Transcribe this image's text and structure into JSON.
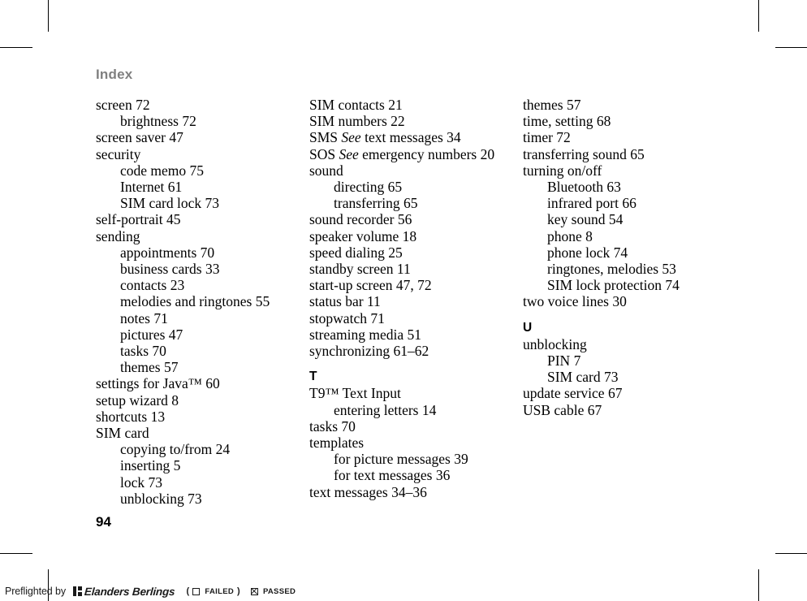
{
  "document": {
    "heading": "Index",
    "page_number": "94",
    "heading_color": "#808080",
    "text_color": "#000000"
  },
  "columns": [
    {
      "id": "column-1",
      "entries": [
        {
          "type": "main",
          "text": "screen 72"
        },
        {
          "type": "sub",
          "text": "brightness 72"
        },
        {
          "type": "main",
          "text": "screen saver 47"
        },
        {
          "type": "main",
          "text": "security"
        },
        {
          "type": "sub",
          "text": "code memo 75"
        },
        {
          "type": "sub",
          "text": "Internet 61"
        },
        {
          "type": "sub",
          "text": "SIM card lock 73"
        },
        {
          "type": "main",
          "text": "self-portrait 45"
        },
        {
          "type": "main",
          "text": "sending"
        },
        {
          "type": "sub",
          "text": "appointments 70"
        },
        {
          "type": "sub",
          "text": "business cards 33"
        },
        {
          "type": "sub",
          "text": "contacts 23"
        },
        {
          "type": "sub",
          "text": "melodies and ringtones 55"
        },
        {
          "type": "sub",
          "text": "notes 71"
        },
        {
          "type": "sub",
          "text": "pictures 47"
        },
        {
          "type": "sub",
          "text": "tasks 70"
        },
        {
          "type": "sub",
          "text": "themes 57"
        },
        {
          "type": "main",
          "text": "settings for Java™ 60"
        },
        {
          "type": "main",
          "text": "setup wizard 8"
        },
        {
          "type": "main",
          "text": "shortcuts 13"
        },
        {
          "type": "main",
          "text": "SIM card"
        },
        {
          "type": "sub",
          "text": "copying to/from 24"
        },
        {
          "type": "sub",
          "text": "inserting 5"
        },
        {
          "type": "sub",
          "text": "lock 73"
        },
        {
          "type": "sub",
          "text": "unblocking 73"
        }
      ]
    },
    {
      "id": "column-2",
      "entries": [
        {
          "type": "main",
          "text": "SIM contacts 21"
        },
        {
          "type": "main",
          "text": "SIM numbers 22"
        },
        {
          "type": "main",
          "text": "SMS ",
          "italic": "See",
          "text_after": " text messages 34"
        },
        {
          "type": "main",
          "text": "SOS ",
          "italic": "See",
          "text_after": " emergency numbers 20"
        },
        {
          "type": "main",
          "text": "sound"
        },
        {
          "type": "sub",
          "text": "directing 65"
        },
        {
          "type": "sub",
          "text": "transferring 65"
        },
        {
          "type": "main",
          "text": "sound recorder 56"
        },
        {
          "type": "main",
          "text": "speaker volume 18"
        },
        {
          "type": "main",
          "text": "speed dialing 25"
        },
        {
          "type": "main",
          "text": "standby screen 11"
        },
        {
          "type": "main",
          "text": "start-up screen 47, 72"
        },
        {
          "type": "main",
          "text": "status bar 11"
        },
        {
          "type": "main",
          "text": "stopwatch 71"
        },
        {
          "type": "main",
          "text": "streaming media 51"
        },
        {
          "type": "main",
          "text": "synchronizing 61–62"
        },
        {
          "type": "letter",
          "text": "T"
        },
        {
          "type": "main",
          "text": "T9™ Text Input"
        },
        {
          "type": "sub",
          "text": "entering letters 14"
        },
        {
          "type": "main",
          "text": "tasks 70"
        },
        {
          "type": "main",
          "text": "templates"
        },
        {
          "type": "sub",
          "text": "for picture messages 39"
        },
        {
          "type": "sub",
          "text": "for text messages 36"
        },
        {
          "type": "main",
          "text": "text messages 34–36"
        }
      ]
    },
    {
      "id": "column-3",
      "entries": [
        {
          "type": "main",
          "text": "themes 57"
        },
        {
          "type": "main",
          "text": "time, setting 68"
        },
        {
          "type": "main",
          "text": "timer 72"
        },
        {
          "type": "main",
          "text": "transferring sound 65"
        },
        {
          "type": "main",
          "text": "turning on/off"
        },
        {
          "type": "sub",
          "text": "Bluetooth 63"
        },
        {
          "type": "sub",
          "text": "infrared port 66"
        },
        {
          "type": "sub",
          "text": "key sound 54"
        },
        {
          "type": "sub",
          "text": "phone 8"
        },
        {
          "type": "sub",
          "text": "phone lock 74"
        },
        {
          "type": "sub",
          "text": "ringtones, melodies 53"
        },
        {
          "type": "sub",
          "text": "SIM lock protection 74"
        },
        {
          "type": "main",
          "text": "two voice lines 30"
        },
        {
          "type": "letter",
          "text": "U"
        },
        {
          "type": "main",
          "text": "unblocking"
        },
        {
          "type": "sub",
          "text": "PIN 7"
        },
        {
          "type": "sub",
          "text": "SIM card 73"
        },
        {
          "type": "main",
          "text": "update service 67"
        },
        {
          "type": "main",
          "text": "USB cable 67"
        }
      ]
    }
  ],
  "preflight": {
    "prefix": "Preflighted by",
    "brand": "Elanders Berlings",
    "open_paren": "(",
    "failed_label": "FAILED",
    "close_paren": ")",
    "passed_label": "PASSED",
    "failed_checked": false,
    "passed_checked": true
  }
}
